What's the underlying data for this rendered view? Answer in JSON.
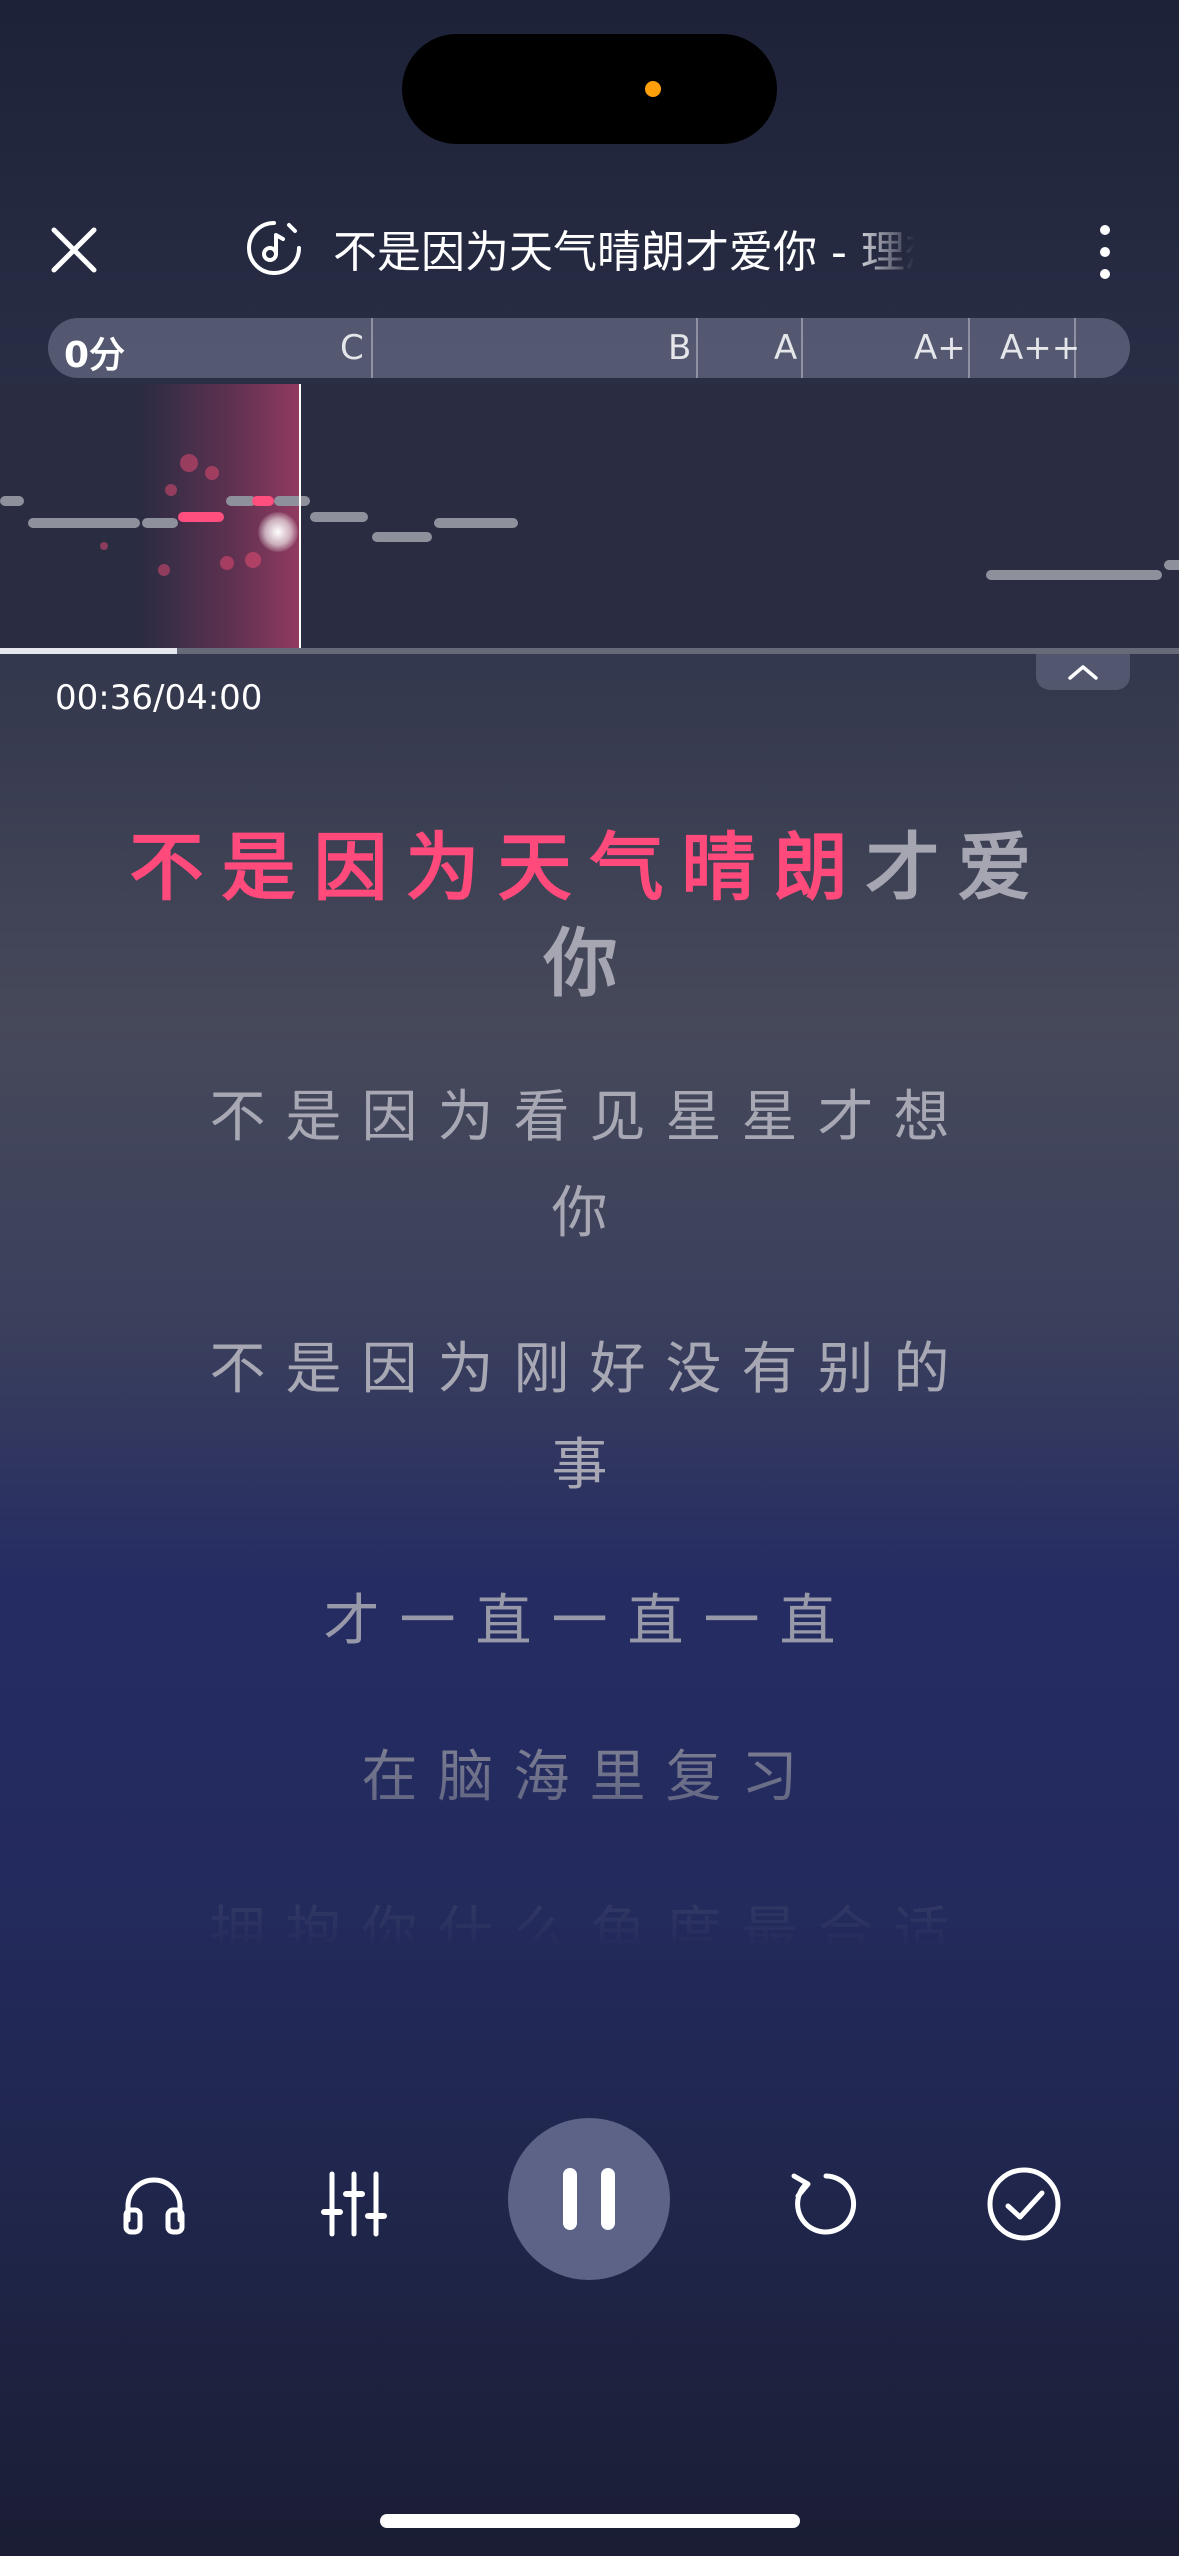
{
  "header": {
    "song_title": "不是因为天气晴朗才爱你 - 理想混蛋"
  },
  "score_bar": {
    "score": "0分",
    "grades": [
      "C",
      "B",
      "A",
      "A+",
      "A++"
    ]
  },
  "playback": {
    "time_readout": "00:36/04:00",
    "progress": 0.15
  },
  "lyrics": {
    "current_sung": "不是因为天气晴朗",
    "current_unsung": "才爱你",
    "next_lines": [
      "不是因为看见星星才想你",
      "不是因为刚好没有别的事",
      "才一直一直一直",
      "在脑海里复习",
      "拥抱你什么角度最合适"
    ]
  },
  "controls": {
    "buttons": [
      "headphones-icon",
      "mixer-sliders-icon",
      "pause-icon",
      "restart-icon",
      "finish-check-icon"
    ]
  },
  "colors": {
    "accent": "#ff4a7b",
    "play_button": "#5d6387"
  }
}
